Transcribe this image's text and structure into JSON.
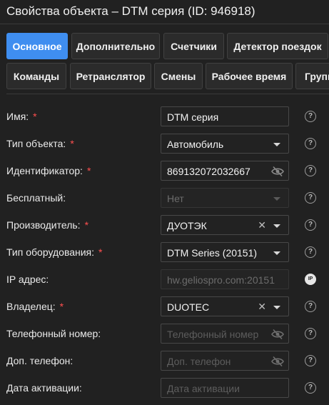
{
  "window": {
    "title": "Свойства объекта – DTM серия (ID: 946918)"
  },
  "tabs": [
    {
      "label": "Основное",
      "active": true
    },
    {
      "label": "Дополнительно"
    },
    {
      "label": "Счетчики"
    },
    {
      "label": "Детектор поездок"
    },
    {
      "label": "Команды"
    },
    {
      "label": "Ретранслятор"
    },
    {
      "label": "Смены"
    },
    {
      "label": "Рабочее время"
    },
    {
      "label": "Групп"
    }
  ],
  "form": {
    "name": {
      "label": "Имя:",
      "required": "*",
      "value": "DTM серия"
    },
    "object_type": {
      "label": "Тип объекта:",
      "required": "*",
      "value": "Автомобиль"
    },
    "identifier": {
      "label": "Идентификатор:",
      "required": "*",
      "value": "869132072032667"
    },
    "free": {
      "label": "Бесплатный:",
      "value": "Нет"
    },
    "manufacturer": {
      "label": "Производитель:",
      "required": "*",
      "value": "ДУОТЭК",
      "clear": "✕"
    },
    "equipment_type": {
      "label": "Тип оборудования:",
      "required": "*",
      "value": "DTM Series (20151)"
    },
    "ip_address": {
      "label": "IP адрес:",
      "value": "hw.geliospro.com:20151"
    },
    "owner": {
      "label": "Владелец:",
      "required": "*",
      "value": "DUOTEC",
      "clear": "✕"
    },
    "phone": {
      "label": "Телефонный номер:",
      "placeholder": "Телефонный номер"
    },
    "extra_phone": {
      "label": "Доп. телефон:",
      "placeholder": "Доп. телефон"
    },
    "activation_date": {
      "label": "Дата активации:",
      "placeholder": "Дата активации"
    }
  },
  "icons": {
    "help": "?",
    "info": "IP"
  },
  "colors": {
    "accent": "#3f8ef0",
    "required": "#ff4f4f",
    "background": "#212121"
  }
}
